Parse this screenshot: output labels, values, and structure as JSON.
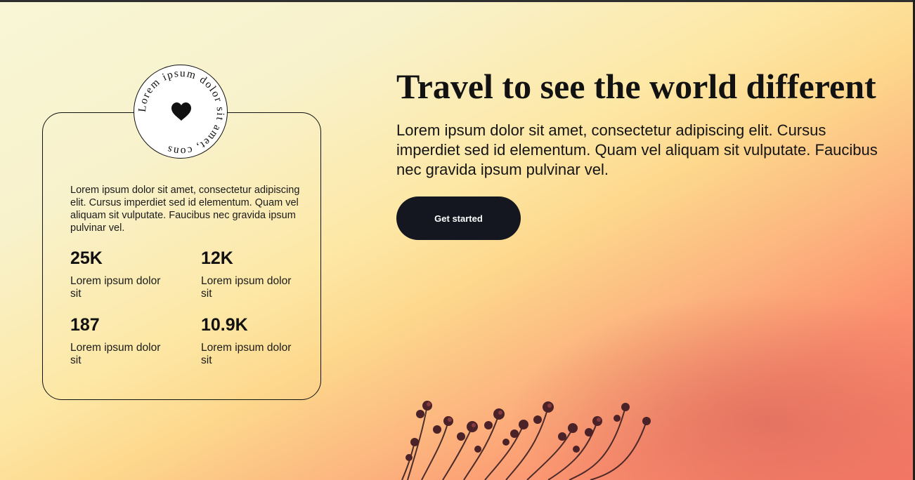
{
  "badge": {
    "ring_text": "Lorem ipsum dolor sit amet, cons",
    "icon": "heart-icon"
  },
  "card": {
    "description": "Lorem ipsum dolor sit amet, consectetur adipiscing elit. Cursus imperdiet sed id elementum. Quam vel aliquam sit vulputate. Faucibus nec gravida ipsum pulvinar vel.",
    "stats": [
      {
        "value": "25K",
        "label": "Lorem ipsum dolor sit"
      },
      {
        "value": "12K",
        "label": "Lorem ipsum dolor sit"
      },
      {
        "value": "187",
        "label": "Lorem ipsum dolor sit"
      },
      {
        "value": "10.9K",
        "label": "Lorem ipsum dolor sit"
      }
    ]
  },
  "hero": {
    "title": "Travel to see the world different",
    "description": "Lorem ipsum dolor sit amet, consectetur adipiscing elit. Cursus imperdiet sed id elementum. Quam vel aliquam sit vulputate. Faucibus nec gravida ipsum pulvinar vel.",
    "cta_label": "Get started"
  },
  "colors": {
    "button_bg": "#141720",
    "button_text": "#ffffff",
    "text_dark": "#121212",
    "gradient_light": "#f8f6d6",
    "gradient_mid": "#fdd88d",
    "gradient_warm": "#f97a66"
  }
}
